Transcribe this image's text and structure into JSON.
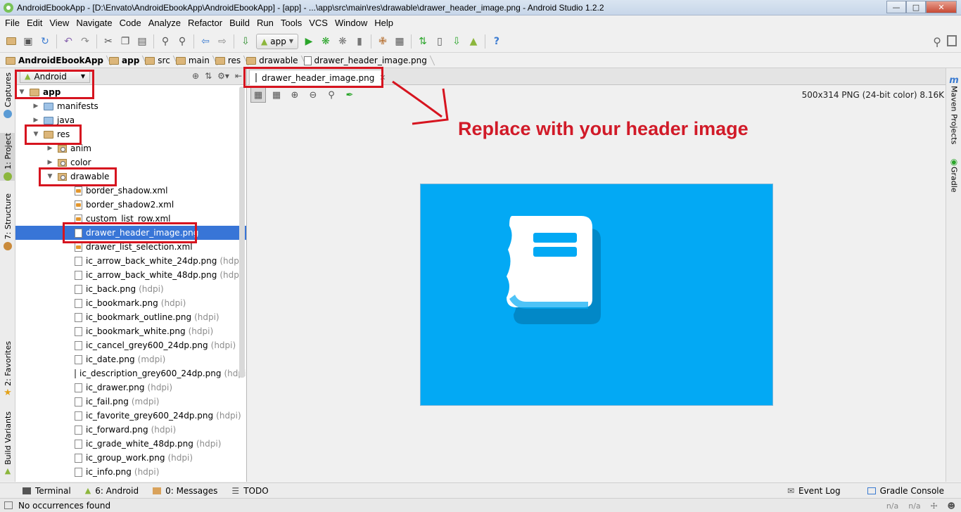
{
  "window": {
    "title": "AndroidEbookApp - [D:\\Envato\\AndroidEbookApp\\AndroidEbookApp] - [app] - ...\\app\\src\\main\\res\\drawable\\drawer_header_image.png - Android Studio 1.2.2"
  },
  "menu": [
    "File",
    "Edit",
    "View",
    "Navigate",
    "Code",
    "Analyze",
    "Refactor",
    "Build",
    "Run",
    "Tools",
    "VCS",
    "Window",
    "Help"
  ],
  "toolbar": {
    "run_config": "app"
  },
  "breadcrumb": [
    "AndroidEbookApp",
    "app",
    "src",
    "main",
    "res",
    "drawable",
    "drawer_header_image.png"
  ],
  "left_tabs": [
    "Captures",
    "1: Project",
    "7: Structure",
    "2: Favorites",
    "Build Variants"
  ],
  "right_tabs": [
    "Maven Projects",
    "Gradle"
  ],
  "project": {
    "view": "Android",
    "tree": [
      {
        "label": "app",
        "qual": ""
      },
      {
        "label": "manifests",
        "qual": ""
      },
      {
        "label": "java",
        "qual": ""
      },
      {
        "label": "res",
        "qual": ""
      },
      {
        "label": "anim",
        "qual": ""
      },
      {
        "label": "color",
        "qual": ""
      },
      {
        "label": "drawable",
        "qual": ""
      },
      {
        "label": "border_shadow.xml",
        "qual": ""
      },
      {
        "label": "border_shadow2.xml",
        "qual": ""
      },
      {
        "label": "custom_list_row.xml",
        "qual": ""
      },
      {
        "label": "drawer_header_image.png",
        "qual": ""
      },
      {
        "label": "drawer_list_selection.xml",
        "qual": ""
      },
      {
        "label": "ic_arrow_back_white_24dp.png",
        "qual": "(hdpi)"
      },
      {
        "label": "ic_arrow_back_white_48dp.png",
        "qual": "(hdpi)"
      },
      {
        "label": "ic_back.png",
        "qual": "(hdpi)"
      },
      {
        "label": "ic_bookmark.png",
        "qual": "(hdpi)"
      },
      {
        "label": "ic_bookmark_outline.png",
        "qual": "(hdpi)"
      },
      {
        "label": "ic_bookmark_white.png",
        "qual": "(hdpi)"
      },
      {
        "label": "ic_cancel_grey600_24dp.png",
        "qual": "(hdpi)"
      },
      {
        "label": "ic_date.png",
        "qual": "(mdpi)"
      },
      {
        "label": "ic_description_grey600_24dp.png",
        "qual": "(hdpi)"
      },
      {
        "label": "ic_drawer.png",
        "qual": "(hdpi)"
      },
      {
        "label": "ic_fail.png",
        "qual": "(mdpi)"
      },
      {
        "label": "ic_favorite_grey600_24dp.png",
        "qual": "(hdpi)"
      },
      {
        "label": "ic_forward.png",
        "qual": "(hdpi)"
      },
      {
        "label": "ic_grade_white_48dp.png",
        "qual": "(hdpi)"
      },
      {
        "label": "ic_group_work.png",
        "qual": "(hdpi)"
      },
      {
        "label": "ic_info.png",
        "qual": "(hdpi)"
      }
    ]
  },
  "editor": {
    "tab_label": "drawer_header_image.png",
    "image_info": "500x314 PNG (24-bit color) 8.16K",
    "annotation": "Replace with your header image",
    "preview_color": "#03a9f4"
  },
  "bottom_bar": {
    "terminal": "Terminal",
    "android": "6: Android",
    "messages": "0: Messages",
    "todo": "TODO",
    "event_log": "Event Log",
    "gradle_console": "Gradle Console"
  },
  "status": {
    "message": "No occurrences found",
    "pos1": "n/a",
    "pos2": "n/a"
  }
}
